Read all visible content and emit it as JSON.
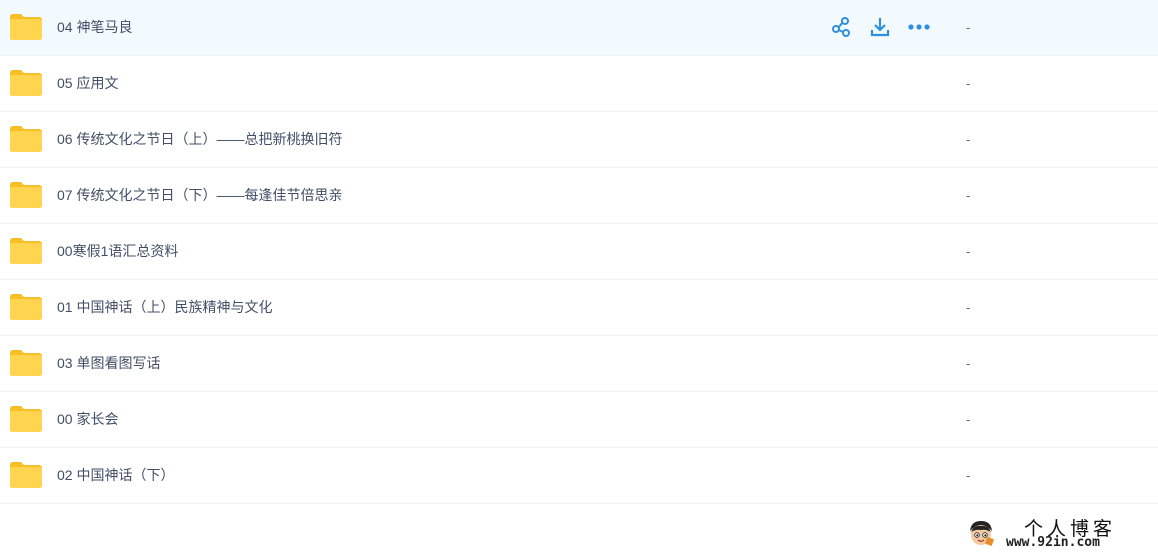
{
  "files": [
    {
      "name": "04 神笔马良",
      "size": "-"
    },
    {
      "name": "05 应用文",
      "size": "-"
    },
    {
      "name": "06 传统文化之节日（上）——总把新桃换旧符",
      "size": "-"
    },
    {
      "name": "07 传统文化之节日（下）——每逢佳节倍思亲",
      "size": "-"
    },
    {
      "name": "00寒假1语汇总资料",
      "size": "-"
    },
    {
      "name": "01 中国神话（上）民族精神与文化",
      "size": "-"
    },
    {
      "name": "03 单图看图写话",
      "size": "-"
    },
    {
      "name": "00 家长会",
      "size": "-"
    },
    {
      "name": "02 中国神话（下）",
      "size": "-"
    }
  ],
  "row_actions": {
    "icons": [
      "share-icon",
      "download-icon",
      "more-icon"
    ]
  },
  "colors": {
    "folder": "#ffd54f",
    "folder_dark": "#f6bf26",
    "action_blue": "#2f8fe0",
    "hover_bg": "#f3faff",
    "text": "#424e67"
  },
  "watermark": {
    "title": "个人博客",
    "url": "www.92in.com"
  }
}
